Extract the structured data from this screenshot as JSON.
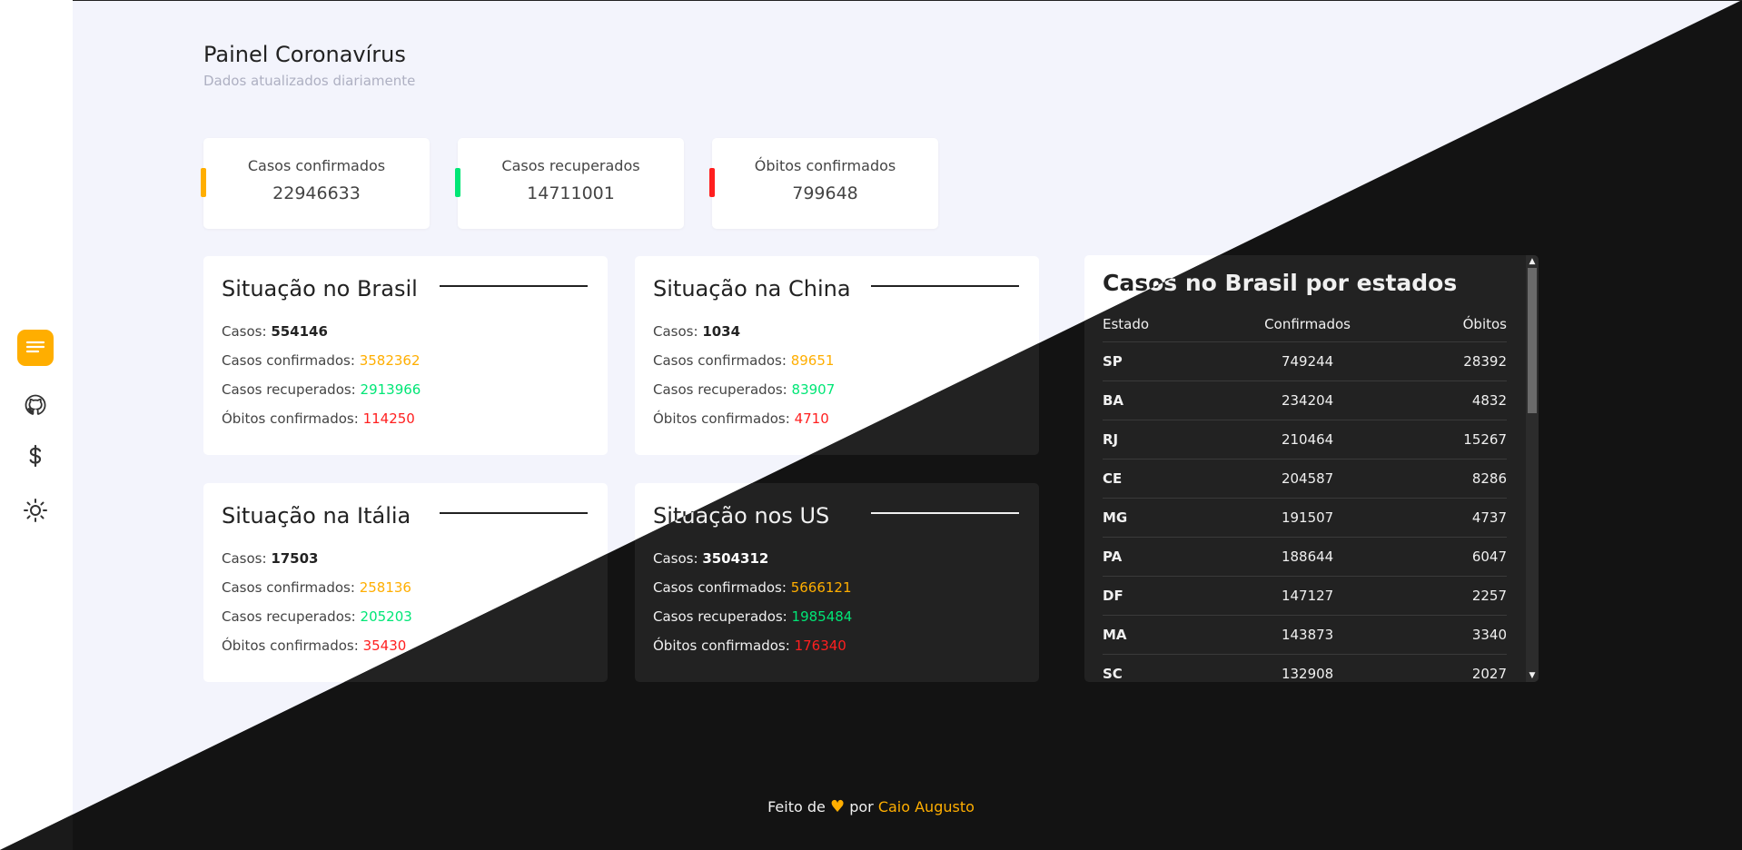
{
  "header": {
    "title": "Painel Coronavírus",
    "subtitle": "Dados atualizados diariamente"
  },
  "sidebar": {
    "items": [
      {
        "icon": "menu-icon",
        "active": true
      },
      {
        "icon": "github-icon"
      },
      {
        "icon": "dollar-icon"
      },
      {
        "icon": "sun-icon"
      }
    ]
  },
  "stats": [
    {
      "label": "Casos confirmados",
      "value": "22946633",
      "color": "#ffae00"
    },
    {
      "label": "Casos recuperados",
      "value": "14711001",
      "color": "#00e676"
    },
    {
      "label": "Óbitos confirmados",
      "value": "799648",
      "color": "#ff1f1f"
    }
  ],
  "countries": [
    {
      "title": "Situação no Brasil",
      "cases_label": "Casos:",
      "cases": "554146",
      "confirmed_label": "Casos confirmados:",
      "confirmed": "3582362",
      "recovered_label": "Casos recuperados:",
      "recovered": "2913966",
      "deaths_label": "Óbitos confirmados:",
      "deaths": "114250"
    },
    {
      "title": "Situação na China",
      "cases_label": "Casos:",
      "cases": "1034",
      "confirmed_label": "Casos confirmados:",
      "confirmed": "89651",
      "recovered_label": "Casos recuperados:",
      "recovered": "83907",
      "deaths_label": "Óbitos confirmados:",
      "deaths": "4710"
    },
    {
      "title": "Situação na Itália",
      "cases_label": "Casos:",
      "cases": "17503",
      "confirmed_label": "Casos confirmados:",
      "confirmed": "258136",
      "recovered_label": "Casos recuperados:",
      "recovered": "205203",
      "deaths_label": "Óbitos confirmados:",
      "deaths": "35430"
    },
    {
      "title": "Situação nos US",
      "cases_label": "Casos:",
      "cases": "3504312",
      "confirmed_label": "Casos confirmados:",
      "confirmed": "5666121",
      "recovered_label": "Casos recuperados:",
      "recovered": "1985484",
      "deaths_label": "Óbitos confirmados:",
      "deaths": "176340"
    }
  ],
  "states_table": {
    "title": "Casos no Brasil por estados",
    "columns": [
      "Estado",
      "Confirmados",
      "Óbitos"
    ],
    "rows": [
      [
        "SP",
        "749244",
        "28392"
      ],
      [
        "BA",
        "234204",
        "4832"
      ],
      [
        "RJ",
        "210464",
        "15267"
      ],
      [
        "CE",
        "204587",
        "8286"
      ],
      [
        "MG",
        "191507",
        "4737"
      ],
      [
        "PA",
        "188644",
        "6047"
      ],
      [
        "DF",
        "147127",
        "2257"
      ],
      [
        "MA",
        "143873",
        "3340"
      ],
      [
        "SC",
        "132908",
        "2027"
      ]
    ]
  },
  "footer": {
    "made_by": "Feito de",
    "heart": "♥",
    "by": "por",
    "author": "Caio Augusto"
  },
  "colors": {
    "accent": "#ffae00",
    "confirmed": "#ffae00",
    "recovered": "#00e676",
    "deaths": "#ff1f1f",
    "light_bg": "#f3f4fc",
    "dark_bg": "#131313"
  }
}
